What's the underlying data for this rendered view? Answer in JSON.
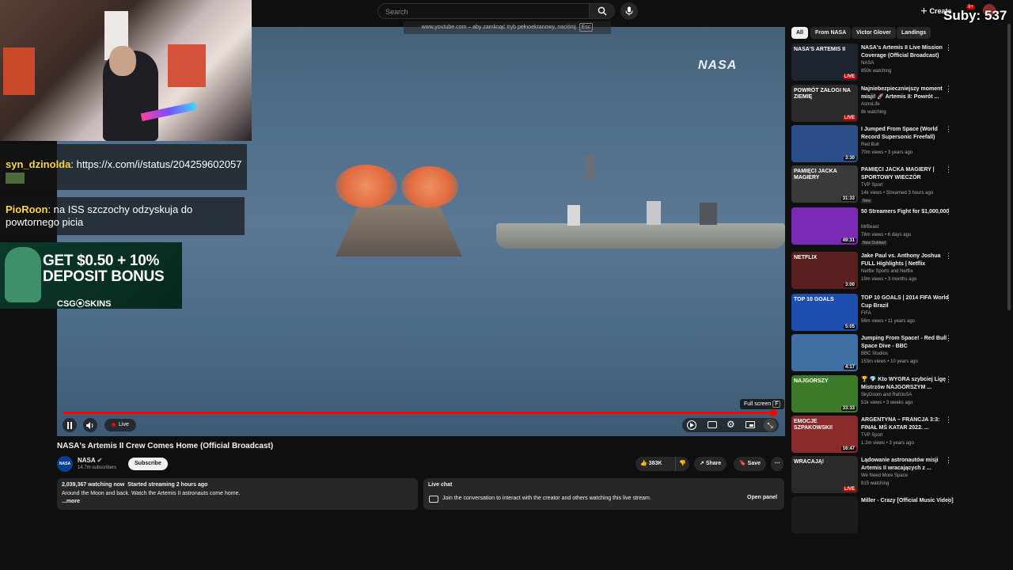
{
  "topbar": {
    "search_placeholder": "Search",
    "create_label": "Create",
    "notifications_count": "9+",
    "overlay_subs": "Suby: 537"
  },
  "player": {
    "exit_hint": "www.youtube.com – aby zamknąć tryb pełnoekranowy, naciśnij",
    "exit_key": "Esc",
    "watermark": "NASA",
    "fullscreen_tip": "Full screen",
    "fullscreen_key": "F",
    "live_label": "Live",
    "progress": 0.99
  },
  "overlay": {
    "chat": [
      {
        "user": "syn_dzinolda",
        "message": ": https://x.com/i/status/204259602057",
        "color": "#f7d44a"
      },
      {
        "user": "PioRoon",
        "message": ": na ISS szczochy odzyskuja do powtornego picia",
        "color": "#f7d44a"
      }
    ],
    "ad_headline": "GET $0.50 + 10% DEPOSIT BONUS",
    "ad_brand": "CSG⦿SKINS"
  },
  "video": {
    "title": "NASA's Artemis II Crew Comes Home (Official Broadcast)",
    "channel": "NASA",
    "channel_avatar_text": "NASA",
    "subscribers": "14.7m subscribers",
    "subscribe_label": "Subscribe",
    "likes": "383K",
    "share_label": "Share",
    "save_label": "Save",
    "stats": "2,039,367 watching now  Started streaming 2 hours ago",
    "description": "Around the Moon and back. Watch the Artemis II astronauts come home.",
    "more_label": "...more"
  },
  "live_chat": {
    "header": "Live chat",
    "text": "Join the conversation to interact with the creator and others watching this live stream.",
    "open_label": "Open panel"
  },
  "sidebar": {
    "chips": [
      "All",
      "From NASA",
      "Victor Glover",
      "Landings"
    ],
    "items": [
      {
        "title": "NASA's Artemis II Live Mission Coverage (Official Broadcast)",
        "channel": "NASA",
        "meta": "850k watching",
        "badge": "LIVE",
        "thumb_text": "NASA'S ARTEMIS II",
        "thumb_color": "#1d2430"
      },
      {
        "title": "Najniebezpieczniejszy moment misji! 🚀 Artemis II: Powrót ...",
        "channel": "AstroLife",
        "meta": "8k watching",
        "badge": "LIVE",
        "thumb_text": "POWRÓT ZAŁOGI NA ZIEMIĘ",
        "thumb_color": "#2a2a2a"
      },
      {
        "title": "I Jumped From Space (World Record Supersonic Freefall)",
        "channel": "Red Bull",
        "meta": "70m views • 3 years ago",
        "badge": "3:30",
        "thumb_text": "",
        "thumb_color": "#2c4f8c"
      },
      {
        "title": "PAMIĘCI JACKA MAGIERY | SPORTOWY WIECZÓR",
        "channel": "TVP Sport",
        "meta": "14k views • Streamed 3 hours ago",
        "badge": "31:33",
        "new": "New",
        "thumb_text": "PAMIĘCI JACKA MAGIERY",
        "thumb_color": "#3a3a3a"
      },
      {
        "title": "50 Streamers Fight for $1,000,000",
        "channel": "MrBeast",
        "meta": "78m views • 6 days ago",
        "badge": "49:31",
        "new": "New   Dubbed",
        "thumb_text": "",
        "thumb_color": "#7b2ab5"
      },
      {
        "title": "Jake Paul vs. Anthony Joshua FULL Highlights | Netflix",
        "channel": "Netflix Sports  and Netflix",
        "meta": "19m views • 3 months ago",
        "badge": "3:00",
        "thumb_text": "NETFLIX",
        "thumb_color": "#5a1f1f"
      },
      {
        "title": "TOP 10 GOALS | 2014 FIFA World Cup Brazil",
        "channel": "FIFA",
        "meta": "56m views • 11 years ago",
        "badge": "5:05",
        "thumb_text": "TOP 10 GOALS",
        "thumb_color": "#1e4fb0"
      },
      {
        "title": "Jumping From Space! - Red Bull Space Dive - BBC",
        "channel": "BBC Studios",
        "meta": "153m views • 10 years ago",
        "badge": "4:17",
        "thumb_text": "",
        "thumb_color": "#3f6fa3"
      },
      {
        "title": "🏆 💎 Kto WYGRA szybciej Ligę Mistrzów NAJGORSZYM ...",
        "channel": "SkyDoom  and RafciuSA",
        "meta": "51k views • 3 weeks ago",
        "badge": "33:33",
        "thumb_text": "NAJGORSZY",
        "thumb_color": "#3d7a2a"
      },
      {
        "title": "ARGENTYNA – FRANCJA 3:3: FINAŁ MŚ KATAR 2022. ...",
        "channel": "TVP Sport",
        "meta": "1.2m views • 3 years ago",
        "badge": "16:47",
        "thumb_text": "EMOCJE SZPAKOWSKI!",
        "thumb_color": "#8a2a2a"
      },
      {
        "title": "Lądowanie astronautów misji Artemis II wracających z ...",
        "channel": "We Need More Space",
        "meta": "815 watching",
        "badge": "LIVE",
        "thumb_text": "WRACAJĄ!",
        "thumb_color": "#2a2a2a"
      },
      {
        "title": "Miller - Crazy [Official Music Video]",
        "channel": "",
        "meta": "",
        "badge": "",
        "thumb_text": "",
        "thumb_color": "#1c1c1c"
      }
    ]
  }
}
